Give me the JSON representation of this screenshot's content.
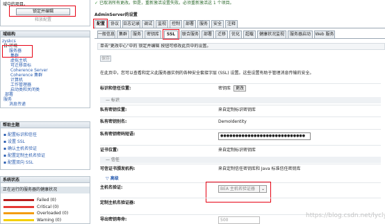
{
  "top_left": {
    "notice": "域中的项目。",
    "lock_button": "锁定并编辑",
    "release_button": "释放配置"
  },
  "notice": {
    "icon": "✓",
    "text": "已取消所有更改。但是，重新激活设置失败。必须重新激活这 1 个项目。"
  },
  "breadcrumb": "AdminServer的设置",
  "tabs_main": [
    "配置",
    "协议",
    "日志记录",
    "调试",
    "监视",
    "控制",
    "部署",
    "服务",
    "安全",
    "注释"
  ],
  "tabs_sub": [
    "一般信息",
    "集群",
    "服务",
    "密钥库",
    "SSL",
    "联合服务",
    "部署",
    "迁移",
    "优化",
    "超载",
    "健康状况监视",
    "服务器启动",
    "Web 服务"
  ],
  "structure": {
    "title": "域结构",
    "items": [
      "zyskcs",
      "日-环境",
      "服务器",
      "集群",
      "虚拟主机",
      "可迁移目标",
      "Coherence Server",
      "Coherence 集群",
      "计算机",
      "工作管理器",
      "启动类和关闭类",
      "部署",
      "服务",
      "消息传递"
    ]
  },
  "help": {
    "title": "帮助主题",
    "links": [
      "配置标识和信任",
      "设置 SSL",
      "确认主机名验证",
      "配置定制主机名验证",
      "配置双向 SSL"
    ]
  },
  "status": {
    "title": "系统状态",
    "subtitle": "正在运行的服务器的健康状况",
    "items": [
      {
        "label": "Failed (0)",
        "color": "#b71c1c"
      },
      {
        "label": "Critical (0)",
        "color": "#e53935"
      },
      {
        "label": "Overloaded (0)",
        "color": "#f39c12"
      },
      {
        "label": "Warning (0)",
        "color": "#f5d000"
      }
    ]
  },
  "main": {
    "hint": "单击\"更改中心\"中的 锁定并编辑 按钮可修改此页中的设置。",
    "save": "保存",
    "desc": "在此页中，您可以查看和定义此服务器实例的各种安全套接字层 (SSL) 设置。这些设置有助于管理消息传输的安全。",
    "rows": [
      {
        "label": "标识和信任位置:",
        "value": "密钥库",
        "button": "更改"
      },
      {
        "section": "— 标识"
      },
      {
        "label": "私有密钥位置:",
        "value": "来自定制标识密钥库"
      },
      {
        "label": "私有密钥别名:",
        "value": "DemoIdentity"
      },
      {
        "label": "私有密钥密码短语:",
        "value": "●●●●●●●●●●●●●●●●●●●●●●●●●●●●"
      },
      {
        "label": "证书位置:",
        "value": "来自定制标识密钥库"
      },
      {
        "section": "— 信任"
      },
      {
        "label": "可信证书颁发机构:",
        "value": "来自定制信任密钥库和 Java 标准信任密钥库"
      },
      {
        "section": "▽ 高级"
      },
      {
        "label": "主机名验证:",
        "value": "BEA 主机名验证器"
      },
      {
        "label": "定制主机名验证器:",
        "value": ""
      },
      {
        "label": "导出密钥寿命:",
        "value": "500"
      }
    ]
  },
  "watermark": "https://blog.csdn.net/lyclyc"
}
